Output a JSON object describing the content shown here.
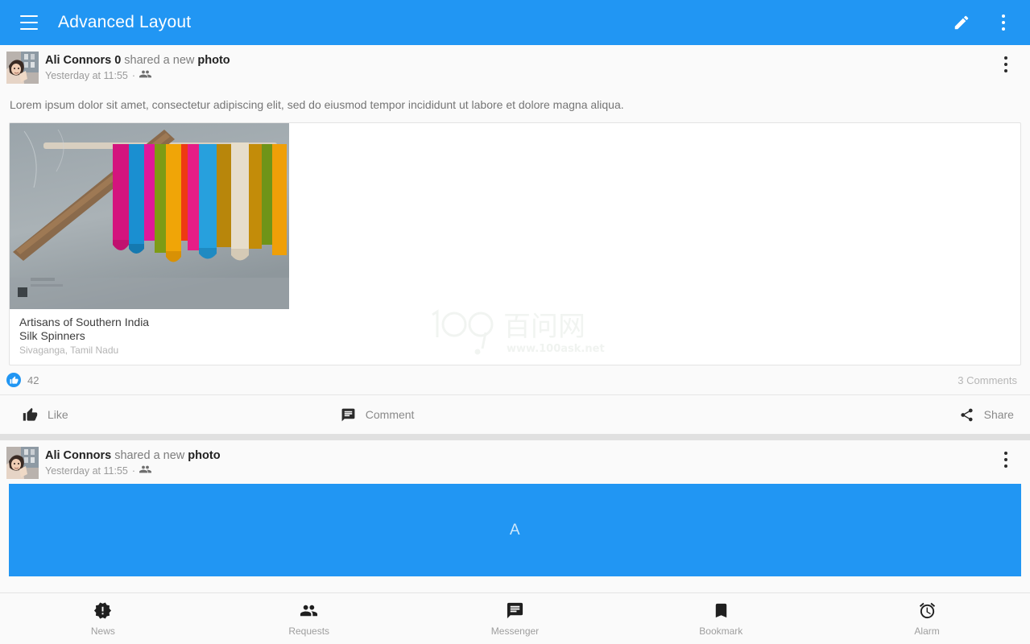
{
  "appbar": {
    "title": "Advanced Layout",
    "menu_icon": "hamburger-menu-icon",
    "edit_icon": "pencil-edit-icon",
    "overflow_icon": "more-vert-icon",
    "background": "#2196f3"
  },
  "posts": [
    {
      "author": "Ali Connors 0",
      "action_pre": "shared a new",
      "action_obj": "photo",
      "timestamp": "Yesterday at 11:55",
      "separator": "·",
      "audience_icon": "group-people-icon",
      "overflow_icon": "more-vert-icon",
      "body": "Lorem ipsum dolor sit amet, consectetur adipiscing elit, sed do eiusmod tempor incididunt ut labore et dolore magna aliqua.",
      "card": {
        "image_alt": "colorful silk yarn skeins hanging on a rod",
        "caption_title": "Artisans of Southern India",
        "caption_subtitle": "Silk Spinners",
        "caption_location": "Sivaganga, Tamil Nadu"
      },
      "stats": {
        "like_icon": "thumb-up-circle-icon",
        "like_count": "42",
        "comments": "3 Comments"
      },
      "actions": {
        "like_label": "Like",
        "like_icon": "thumb-up-icon",
        "comment_label": "Comment",
        "comment_icon": "comment-icon",
        "share_label": "Share",
        "share_icon": "share-icon"
      }
    },
    {
      "author": "Ali Connors",
      "action_pre": "shared a new",
      "action_obj": "photo",
      "timestamp": "Yesterday at 11:55",
      "separator": "·",
      "audience_icon": "group-people-icon",
      "overflow_icon": "more-vert-icon",
      "placeholder_letter": "A",
      "placeholder_color": "#2196f3"
    }
  ],
  "watermark": {
    "logo_text": "100",
    "cn_text": "百问网",
    "url_text": "www.100ask.net"
  },
  "bottom_nav": [
    {
      "label": "News",
      "icon": "alert-badge-icon"
    },
    {
      "label": "Requests",
      "icon": "people-group-icon"
    },
    {
      "label": "Messenger",
      "icon": "chat-message-icon"
    },
    {
      "label": "Bookmark",
      "icon": "bookmark-icon"
    },
    {
      "label": "Alarm",
      "icon": "alarm-clock-icon"
    }
  ]
}
